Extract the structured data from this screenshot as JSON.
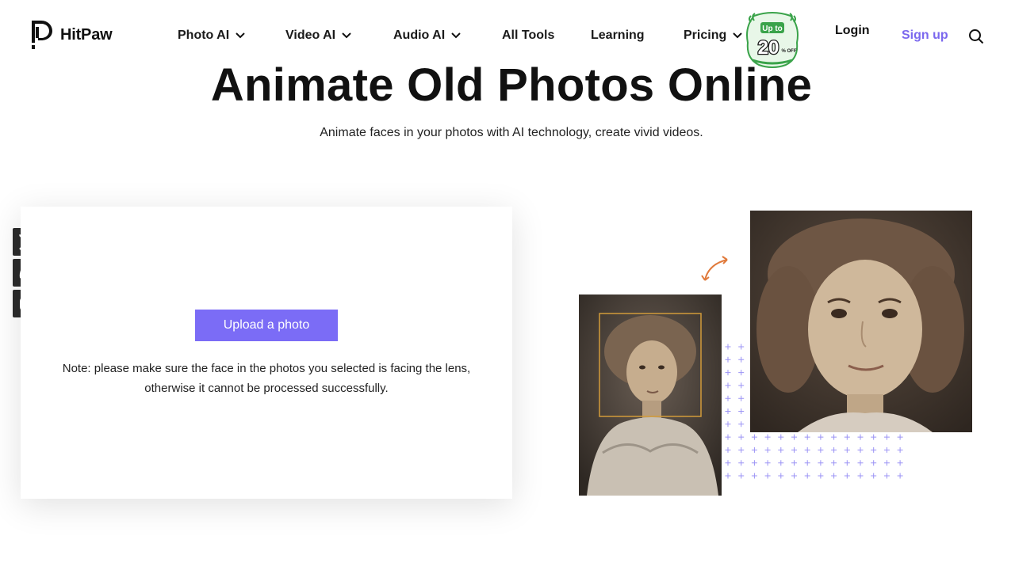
{
  "brand": {
    "name": "HitPaw"
  },
  "nav": {
    "items": [
      {
        "label": "Photo AI",
        "dropdown": true
      },
      {
        "label": "Video AI",
        "dropdown": true
      },
      {
        "label": "Audio AI",
        "dropdown": true
      },
      {
        "label": "All Tools",
        "dropdown": false
      },
      {
        "label": "Learning",
        "dropdown": false
      },
      {
        "label": "Pricing",
        "dropdown": true
      }
    ],
    "promo": {
      "top": "Up to",
      "value": "20",
      "suffix": "% OFF"
    },
    "login": "Login",
    "signup": "Sign up"
  },
  "hero": {
    "title": "Animate Old Photos Online",
    "subtitle": "Animate faces in your photos with AI technology, create vivid videos."
  },
  "social": [
    "x-icon",
    "discord-icon",
    "instagram-icon"
  ],
  "upload": {
    "button": "Upload a photo",
    "note": "Note: please make sure the face in the photos you selected is facing the lens, otherwise it cannot be processed successfully."
  },
  "colors": {
    "accent": "#7b6cf6",
    "signup": "#7b68ee",
    "arrow": "#e07a3c",
    "promo_green": "#4caf50",
    "plus": "#9b93f5"
  }
}
